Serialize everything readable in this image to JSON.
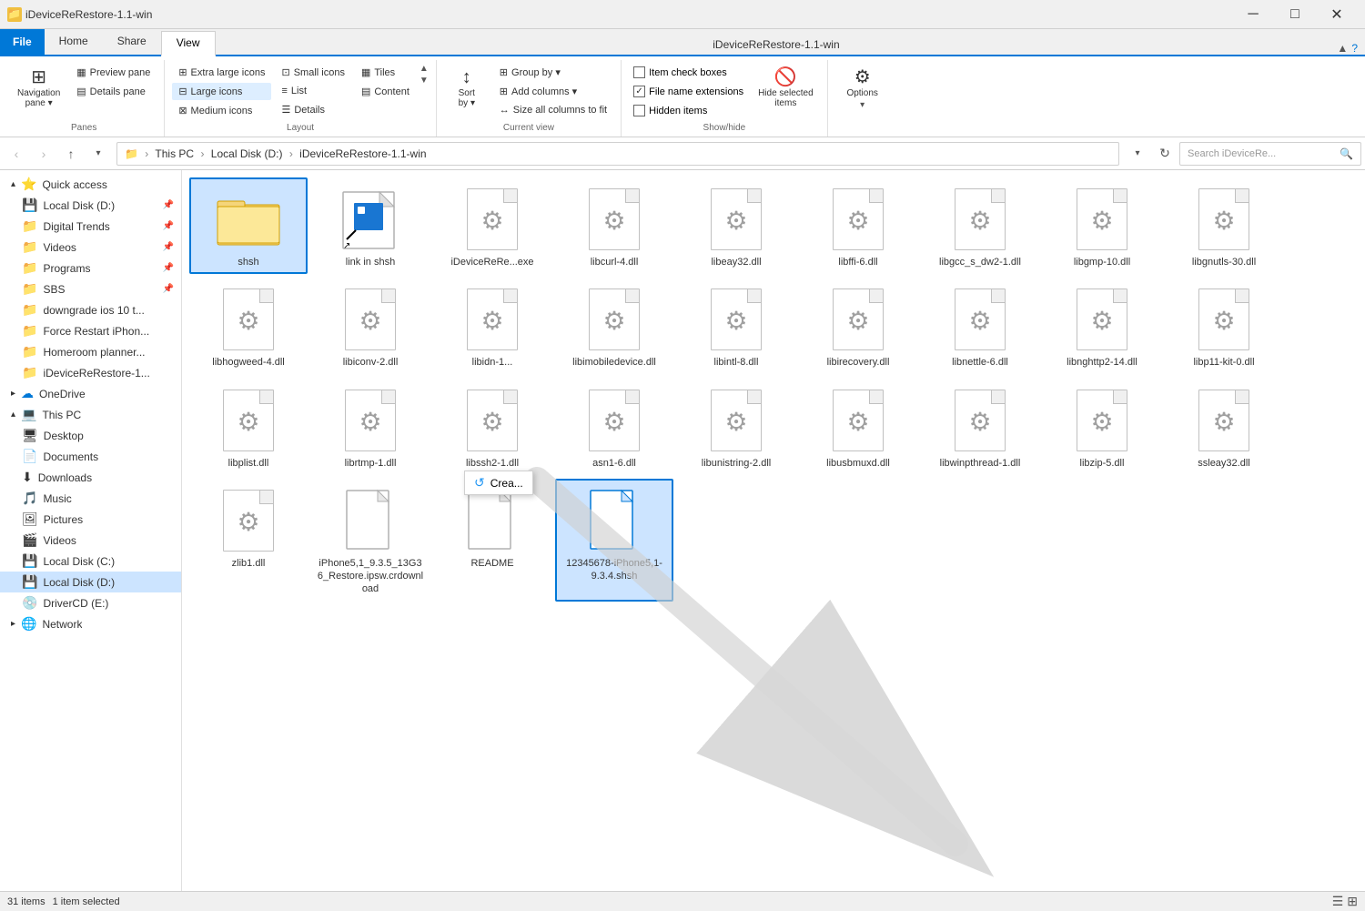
{
  "titleBar": {
    "title": "iDeviceReRestore-1.1-win",
    "icon": "📁",
    "controls": {
      "minimize": "─",
      "maximize": "□",
      "close": "✕"
    }
  },
  "ribbon": {
    "tabs": [
      {
        "id": "file",
        "label": "File",
        "type": "file"
      },
      {
        "id": "home",
        "label": "Home",
        "active": false
      },
      {
        "id": "share",
        "label": "Share",
        "active": false
      },
      {
        "id": "view",
        "label": "View",
        "active": true
      }
    ],
    "titleText": "iDeviceReRestore-1.1-win",
    "groups": {
      "panes": {
        "label": "Panes",
        "navigationPane": {
          "label": "Navigation\npane",
          "icon": "⊞"
        },
        "previewPane": {
          "label": "Preview pane",
          "icon": "▦"
        },
        "detailsPane": {
          "label": "Details pane",
          "icon": "▤"
        }
      },
      "layout": {
        "label": "Layout",
        "extraLargeIcons": "Extra large icons",
        "largeIcons": "Large icons",
        "mediumIcons": "Medium icons",
        "smallIcons": "Small icons",
        "list": "List",
        "details": "Details",
        "tiles": "Tiles",
        "content": "Content"
      },
      "currentView": {
        "label": "Current view",
        "sortBy": "Sort by",
        "groupBy": "Group by ▾",
        "addColumns": "Add columns ▾",
        "sizeAllColumns": "Size all columns to fit"
      },
      "showHide": {
        "label": "Show/hide",
        "itemCheckBoxes": "Item check boxes",
        "fileNameExtensions": "File name extensions",
        "hiddenItems": "Hidden items",
        "hideSelectedItems": "Hide selected\nitems"
      },
      "options": {
        "label": "",
        "options": "Options"
      }
    }
  },
  "navBar": {
    "back": "‹",
    "forward": "›",
    "up": "↑",
    "breadcrumb": "This PC › Local Disk (D:) › iDeviceReRestore-1.1-win",
    "searchPlaceholder": "Search iDeviceRe...",
    "refresh": "↻"
  },
  "sidebar": {
    "quickAccess": {
      "label": "Quick access",
      "icon": "⭐",
      "items": [
        {
          "id": "local-disk-d",
          "label": "Local Disk (D:)",
          "icon": "💾",
          "pinned": true
        },
        {
          "id": "digital-trends",
          "label": "Digital Trends",
          "icon": "📁",
          "pinned": true
        },
        {
          "id": "videos",
          "label": "Videos",
          "icon": "📁",
          "pinned": true
        },
        {
          "id": "programs",
          "label": "Programs",
          "icon": "📁",
          "pinned": true
        },
        {
          "id": "sbs",
          "label": "SBS",
          "icon": "📁",
          "pinned": true
        },
        {
          "id": "downgrade-ios",
          "label": "downgrade ios 10 t...",
          "icon": "📁"
        },
        {
          "id": "force-restart",
          "label": "Force Restart iPhon...",
          "icon": "📁"
        },
        {
          "id": "homeroom",
          "label": "Homeroom planner...",
          "icon": "📁"
        },
        {
          "id": "idevice-restore",
          "label": "iDeviceReRestore-1...",
          "icon": "📁"
        }
      ]
    },
    "oneDrive": {
      "label": "OneDrive",
      "icon": "☁"
    },
    "thisPC": {
      "label": "This PC",
      "icon": "💻",
      "items": [
        {
          "id": "desktop",
          "label": "Desktop",
          "icon": "🖥"
        },
        {
          "id": "documents",
          "label": "Documents",
          "icon": "📄"
        },
        {
          "id": "downloads",
          "label": "Downloads",
          "icon": "⬇"
        },
        {
          "id": "music",
          "label": "Music",
          "icon": "🎵"
        },
        {
          "id": "pictures",
          "label": "Pictures",
          "icon": "🖼"
        },
        {
          "id": "videos2",
          "label": "Videos",
          "icon": "🎬"
        },
        {
          "id": "local-c",
          "label": "Local Disk (C:)",
          "icon": "💾"
        },
        {
          "id": "local-d",
          "label": "Local Disk (D:)",
          "icon": "💾",
          "active": true
        },
        {
          "id": "driver-cd",
          "label": "DriverCD (E:)",
          "icon": "💿"
        }
      ]
    },
    "network": {
      "label": "Network",
      "icon": "🌐"
    }
  },
  "files": [
    {
      "id": "shsh-folder",
      "name": "shsh",
      "type": "folder",
      "selected": true
    },
    {
      "id": "link-in-shsh",
      "name": "link in shsh",
      "type": "shortcut",
      "selected": false
    },
    {
      "id": "idevice-exe",
      "name": "iDeviceReRe...exe",
      "type": "dll",
      "selected": false
    },
    {
      "id": "libcurl",
      "name": "libcurl-4.dll",
      "type": "dll",
      "selected": false
    },
    {
      "id": "libeay32",
      "name": "libeay32.dll",
      "type": "dll",
      "selected": false
    },
    {
      "id": "libffi",
      "name": "libffi-6.dll",
      "type": "dll",
      "selected": false
    },
    {
      "id": "libgcc",
      "name": "libgcc_s_dw2-1.dll",
      "type": "dll",
      "selected": false
    },
    {
      "id": "libgmp",
      "name": "libgmp-10.dll",
      "type": "dll",
      "selected": false
    },
    {
      "id": "libgnutls",
      "name": "libgnutls-30.dll",
      "type": "dll",
      "selected": false
    },
    {
      "id": "libhogweed",
      "name": "libhogweed-4.dll",
      "type": "dll",
      "selected": false
    },
    {
      "id": "libiconv",
      "name": "libiconv-2.dll",
      "type": "dll",
      "selected": false
    },
    {
      "id": "libidn",
      "name": "libidn-1...",
      "type": "dll",
      "selected": false
    },
    {
      "id": "libimobiledevice",
      "name": "libimobiledevice.dll",
      "type": "dll",
      "selected": false
    },
    {
      "id": "libintl",
      "name": "libintl-8.dll",
      "type": "dll",
      "selected": false
    },
    {
      "id": "libirecovery",
      "name": "libirecovery.dll",
      "type": "dll",
      "selected": false
    },
    {
      "id": "libnettle",
      "name": "libnettle-6.dll",
      "type": "dll",
      "selected": false
    },
    {
      "id": "libnghttp2",
      "name": "libnghttp2-14.dll",
      "type": "dll",
      "selected": false
    },
    {
      "id": "libp11",
      "name": "libp11-kit-0.dll",
      "type": "dll",
      "selected": false
    },
    {
      "id": "libplist",
      "name": "libplist.dll",
      "type": "dll",
      "selected": false
    },
    {
      "id": "librtmp",
      "name": "librtmp-1.dll",
      "type": "dll",
      "selected": false
    },
    {
      "id": "libssh2",
      "name": "libssh2-1.dll",
      "type": "dll",
      "selected": false
    },
    {
      "id": "libsn1",
      "name": "asn1-6.dll",
      "type": "dll",
      "selected": false
    },
    {
      "id": "libunistring",
      "name": "libunistring-2.dll",
      "type": "dll",
      "selected": false
    },
    {
      "id": "libusbmuxd",
      "name": "libusbmuxd.dll",
      "type": "dll",
      "selected": false
    },
    {
      "id": "libwinpthread",
      "name": "libwinpthread-1.dll",
      "type": "dll",
      "selected": false
    },
    {
      "id": "libzip",
      "name": "libzip-5.dll",
      "type": "dll",
      "selected": false
    },
    {
      "id": "ssleay32",
      "name": "ssleay32.dll",
      "type": "dll",
      "selected": false
    },
    {
      "id": "zlib1",
      "name": "zlib1.dll",
      "type": "dll",
      "selected": false
    },
    {
      "id": "iphone-restore",
      "name": "iPhone5,1_9.3.5_13G36_Restore.ipsw.crdownload",
      "type": "dll",
      "selected": false
    },
    {
      "id": "readme",
      "name": "README",
      "type": "plain",
      "selected": false
    },
    {
      "id": "shsh-file",
      "name": "12345678-iPhone5,1-9.3.4.shsh",
      "type": "plain",
      "selected": true
    }
  ],
  "renameContext": {
    "icon": "↺",
    "label": "Crea...",
    "visible": true
  },
  "statusBar": {
    "itemCount": "31 items",
    "selectedCount": "1 item selected"
  }
}
